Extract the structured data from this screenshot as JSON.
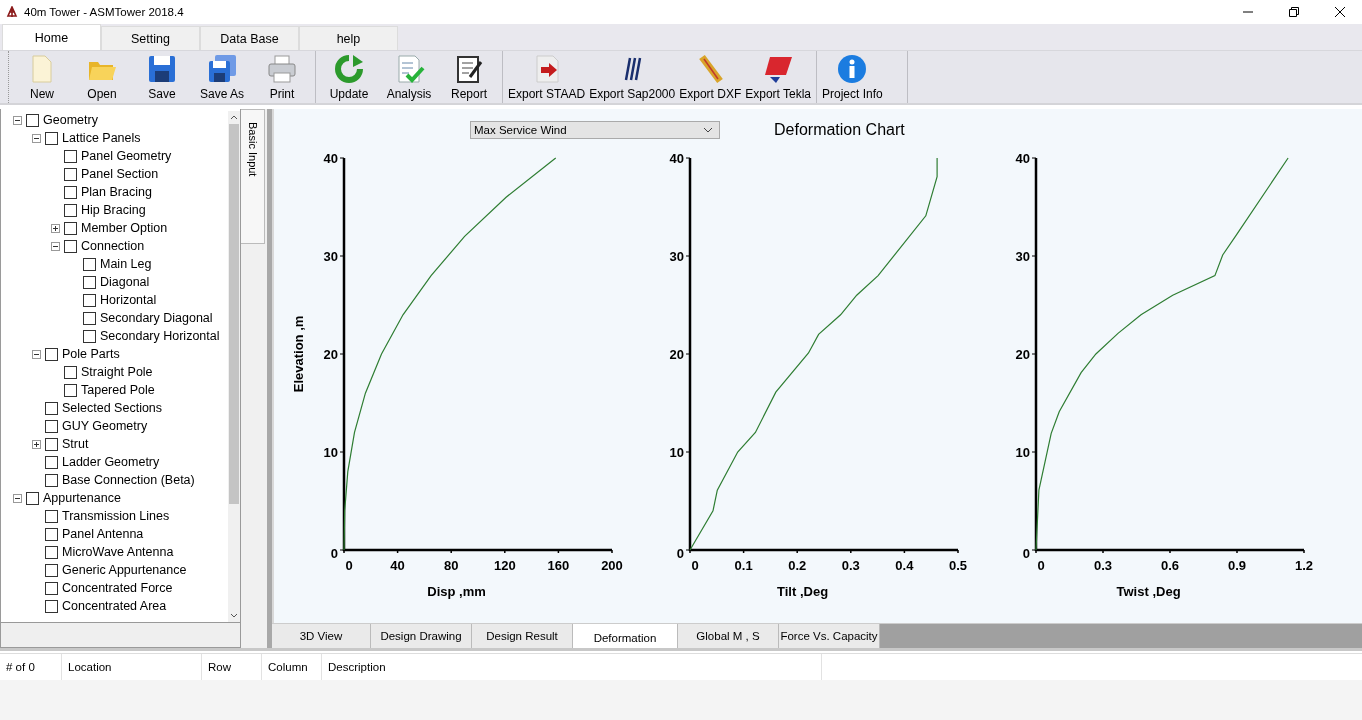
{
  "window": {
    "title": "40m Tower - ASMTower 2018.4"
  },
  "tabs": [
    {
      "label": "Home",
      "selected": true
    },
    {
      "label": "Setting",
      "selected": false
    },
    {
      "label": "Data Base",
      "selected": false
    },
    {
      "label": "help",
      "selected": false
    }
  ],
  "toolbar": [
    [
      {
        "label": "New",
        "kind": "new"
      },
      {
        "label": "Open",
        "kind": "open"
      },
      {
        "label": "Save",
        "kind": "save"
      },
      {
        "label": "Save As",
        "kind": "saveas"
      },
      {
        "label": "Print",
        "kind": "print"
      }
    ],
    [
      {
        "label": "Update",
        "kind": "update"
      },
      {
        "label": "Analysis",
        "kind": "analysis"
      },
      {
        "label": "Report",
        "kind": "report"
      }
    ],
    [
      {
        "label": "Export STAAD",
        "kind": "staad"
      },
      {
        "label": "Export Sap2000",
        "kind": "sap"
      },
      {
        "label": "Export DXF",
        "kind": "dxf"
      },
      {
        "label": "Export Tekla",
        "kind": "tekla"
      }
    ],
    [
      {
        "label": "Project Info",
        "kind": "info"
      }
    ]
  ],
  "tree": [
    {
      "label": "Geometry",
      "checked": false,
      "expanded": true,
      "children": [
        {
          "label": "Lattice Panels",
          "checked": false,
          "expanded": true,
          "children": [
            {
              "label": "Panel Geometry",
              "checked": false
            },
            {
              "label": "Panel Section",
              "checked": false
            },
            {
              "label": "Plan Bracing",
              "checked": false
            },
            {
              "label": "Hip Bracing",
              "checked": false
            },
            {
              "label": "Member Option",
              "checked": false,
              "expanded": false
            },
            {
              "label": "Connection",
              "checked": false,
              "expanded": true,
              "children": [
                {
                  "label": "Main Leg",
                  "checked": false
                },
                {
                  "label": "Diagonal",
                  "checked": false
                },
                {
                  "label": "Horizontal",
                  "checked": false
                },
                {
                  "label": "Secondary Diagonal",
                  "checked": false
                },
                {
                  "label": "Secondary Horizontal",
                  "checked": false
                }
              ]
            }
          ]
        },
        {
          "label": "Pole Parts",
          "checked": false,
          "expanded": true,
          "children": [
            {
              "label": "Straight Pole",
              "checked": false
            },
            {
              "label": "Tapered Pole",
              "checked": false
            }
          ]
        },
        {
          "label": "Selected Sections",
          "checked": false
        },
        {
          "label": "GUY Geometry",
          "checked": false
        },
        {
          "label": "Strut",
          "checked": false,
          "expanded": false
        },
        {
          "label": "Ladder Geometry",
          "checked": false
        },
        {
          "label": "Base Connection (Beta)",
          "checked": false
        }
      ]
    },
    {
      "label": "Appurtenance",
      "checked": false,
      "expanded": true,
      "children": [
        {
          "label": "Transmission Lines",
          "checked": false
        },
        {
          "label": "Panel Antenna",
          "checked": false
        },
        {
          "label": "MicroWave Antenna",
          "checked": false
        },
        {
          "label": "Generic Appurtenance",
          "checked": false
        },
        {
          "label": "Concentrated Force",
          "checked": false
        },
        {
          "label": "Concentrated Area",
          "checked": false
        }
      ]
    }
  ],
  "side_tab": {
    "label": "Basic Input"
  },
  "load_case": {
    "value": "Max Service Wind"
  },
  "chart_title": "Deformation Chart",
  "charts": [
    {
      "chart_data": {
        "type": "line",
        "xlabel": "Disp ,mm",
        "ylabel": "Elevation ,m",
        "x": [
          0,
          0.5,
          2.8,
          7.8,
          16,
          28,
          44,
          65,
          90,
          121,
          158
        ],
        "series": [
          {
            "color": "#2e7d32",
            "values": [
              0,
              4,
              8,
              12,
              16,
              20,
              24,
              28,
              32,
              36,
              40
            ]
          }
        ],
        "xlim": [
          0,
          200
        ],
        "ylim": [
          0,
          40
        ],
        "xticks": [
          0,
          40,
          80,
          120,
          160,
          200
        ],
        "yticks": [
          0,
          10,
          20,
          30,
          40
        ]
      }
    },
    {
      "chart_data": {
        "type": "line",
        "xlabel": "Tilt ,Deg",
        "x": [
          0,
          0.043,
          0.051,
          0.089,
          0.122,
          0.16,
          0.221,
          0.24,
          0.281,
          0.311,
          0.351,
          0.44,
          0.461,
          0.461
        ],
        "series": [
          {
            "color": "#2e7d32",
            "values": [
              0,
              4,
              6.1,
              10,
              12,
              16.1,
              20.1,
              22,
              24,
              26,
              28,
              34.1,
              38.1,
              40
            ]
          }
        ],
        "xlim": [
          0,
          0.5
        ],
        "ylim": [
          0,
          40
        ],
        "xticks": [
          0,
          0.1,
          0.2,
          0.3,
          0.4,
          0.5
        ],
        "yticks": [
          0,
          10,
          20,
          30,
          40
        ]
      }
    },
    {
      "chart_data": {
        "type": "line",
        "xlabel": "Twist ,Deg",
        "x": [
          0,
          0.013,
          0.068,
          0.104,
          0.202,
          0.268,
          0.367,
          0.47,
          0.612,
          0.801,
          0.836,
          0.896,
          1.129
        ],
        "series": [
          {
            "color": "#2e7d32",
            "values": [
              0,
              6.1,
              11.9,
              14.1,
              18.1,
              20,
              22.1,
              24,
              26,
              28,
              30.1,
              32.1,
              40
            ]
          }
        ],
        "xlim": [
          0,
          1.2
        ],
        "ylim": [
          0,
          40
        ],
        "xticks": [
          0,
          0.3,
          0.6,
          0.9,
          1.2
        ],
        "yticks": [
          0,
          10,
          20,
          30,
          40
        ]
      }
    }
  ],
  "view_tabs": [
    {
      "label": "3D View",
      "selected": false
    },
    {
      "label": "Design Drawing",
      "selected": false
    },
    {
      "label": "Design Result",
      "selected": false
    },
    {
      "label": "Deformation",
      "selected": true
    },
    {
      "label": "Global M , S",
      "selected": false
    },
    {
      "label": "Force Vs. Capacity",
      "selected": false
    }
  ],
  "messages": {
    "columns": [
      "# of 0",
      "Location",
      "Row",
      "Column",
      "Description"
    ]
  }
}
